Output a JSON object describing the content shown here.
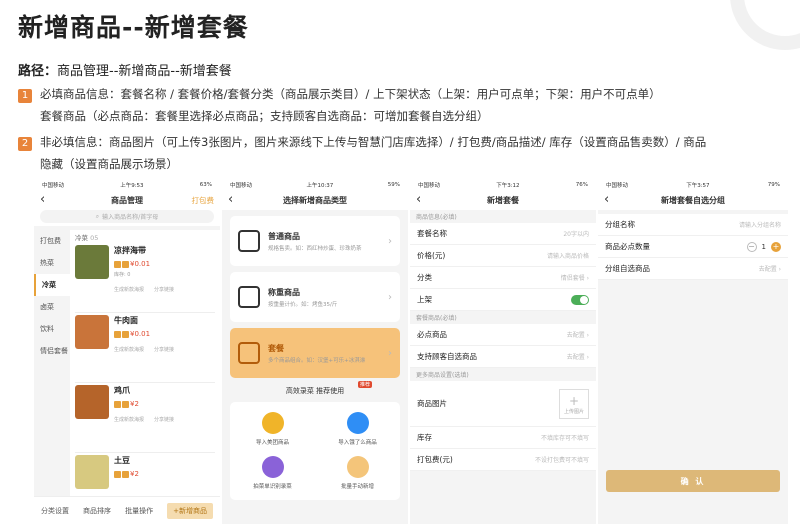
{
  "heading": "新增商品--新增套餐",
  "path": {
    "label": "路径：",
    "value": "商品管理--新增商品--新增套餐"
  },
  "notes": [
    {
      "num": "1",
      "lines": [
        "必填商品信息：套餐名称 / 套餐价格/套餐分类（商品展示类目）/ 上下架状态（上架：用户可点单；下架：用户不可点单）",
        "套餐商品（必点商品：套餐里选择必点商品；支持顾客自选商品：可增加套餐自选分组）"
      ]
    },
    {
      "num": "2",
      "lines": [
        "非必填信息：商品图片（可上传3张图片，图片来源线下上传与智慧门店库选择）/ 打包费/商品描述/ 库存（设置商品售卖数）/ 商品",
        "隐藏（设置商品展示场景）"
      ]
    }
  ],
  "phone1": {
    "status": {
      "carrier": "中国移动",
      "time": "上午9:53",
      "battery": "63%"
    },
    "title": "商品管理",
    "right": "打包费",
    "back": "‹",
    "search_placeholder": "输入商品名称/首字母",
    "sidebar": [
      "打包费",
      "热菜",
      "冷菜",
      "卤菜",
      "饮料",
      "情侣套餐"
    ],
    "active_index": 2,
    "category": "冷菜",
    "category_count": "05",
    "items": [
      {
        "name": "凉拌海带",
        "price": "¥0.01",
        "meta": "库存: 0",
        "a1": "生成新款海报",
        "a2": "分享链接",
        "color": "#6b7a3a"
      },
      {
        "name": "牛肉面",
        "price": "¥0.01",
        "meta": "",
        "a1": "生成新款海报",
        "a2": "分享链接",
        "color": "#c9743a"
      },
      {
        "name": "鸡爪",
        "price": "¥2",
        "meta": "",
        "a1": "生成新款海报",
        "a2": "分享链接",
        "color": "#b5642a"
      },
      {
        "name": "土豆",
        "price": "¥2",
        "meta": "",
        "a1": "",
        "a2": "",
        "color": "#d7c980"
      }
    ],
    "bottom": [
      "分类设置",
      "商品排序",
      "批量操作",
      "+新增商品"
    ]
  },
  "phone2": {
    "status": {
      "carrier": "中国移动",
      "time": "上午10:37",
      "battery": "59%"
    },
    "title": "选择新增商品类型",
    "back": "‹",
    "cards": [
      {
        "t": "普通商品",
        "d": "规格售卖。如：西红柿炒蛋、珍珠奶茶"
      },
      {
        "t": "称重商品",
        "d": "按重量计价。如：烤鱼35/斤"
      },
      {
        "t": "套餐",
        "d": "多个商品组合。如：汉堡+可乐+冰淇淋"
      }
    ],
    "rec_label": "高效录菜 推荐使用",
    "rec_badge": "推荐",
    "grid": [
      {
        "t": "导入美团商品",
        "color": "#f0b429"
      },
      {
        "t": "导入饿了么商品",
        "color": "#2f8ef5"
      },
      {
        "t": "拍菜单识别录菜",
        "color": "#8a62d8"
      },
      {
        "t": "批量手动新增",
        "color": "#f4c57a"
      }
    ]
  },
  "phone3": {
    "status": {
      "carrier": "中国移动",
      "time": "下午3:12",
      "battery": "76%"
    },
    "title": "新增套餐",
    "back": "‹",
    "sec1": "商品信息(必填)",
    "rows1": [
      {
        "l": "套餐名称",
        "r": "20字以内"
      },
      {
        "l": "价格(元)",
        "r": "请输入商品价格"
      },
      {
        "l": "分类",
        "r": "情侣套餐 ›"
      },
      {
        "l": "上架",
        "r": ""
      }
    ],
    "sec2": "套餐商品(必填)",
    "rows2": [
      {
        "l": "必点商品",
        "r": "去配置 ›"
      },
      {
        "l": "支持顾客自选商品",
        "r": "去配置 ›"
      }
    ],
    "sec3": "更多商品设置(选填)",
    "img_label": "商品图片",
    "upload": "上传图片",
    "rows3": [
      {
        "l": "库存",
        "r": "不填库存可不填写"
      },
      {
        "l": "打包费(元)",
        "r": "不设打包费可不填写"
      }
    ]
  },
  "phone4": {
    "status": {
      "carrier": "中国移动",
      "time": "下午3:57",
      "battery": "79%"
    },
    "title": "新增套餐自选分组",
    "back": "‹",
    "rows": [
      {
        "l": "分组名称",
        "r": "请输入分组名称"
      },
      {
        "l": "商品必点数量",
        "r": "1"
      },
      {
        "l": "分组自选商品",
        "r": "去配置 ›"
      }
    ],
    "confirm": "确 认"
  },
  "colors": {
    "accent": "#e7a23a",
    "number_badge": "#e8843a",
    "switch_on": "#4cae58"
  }
}
